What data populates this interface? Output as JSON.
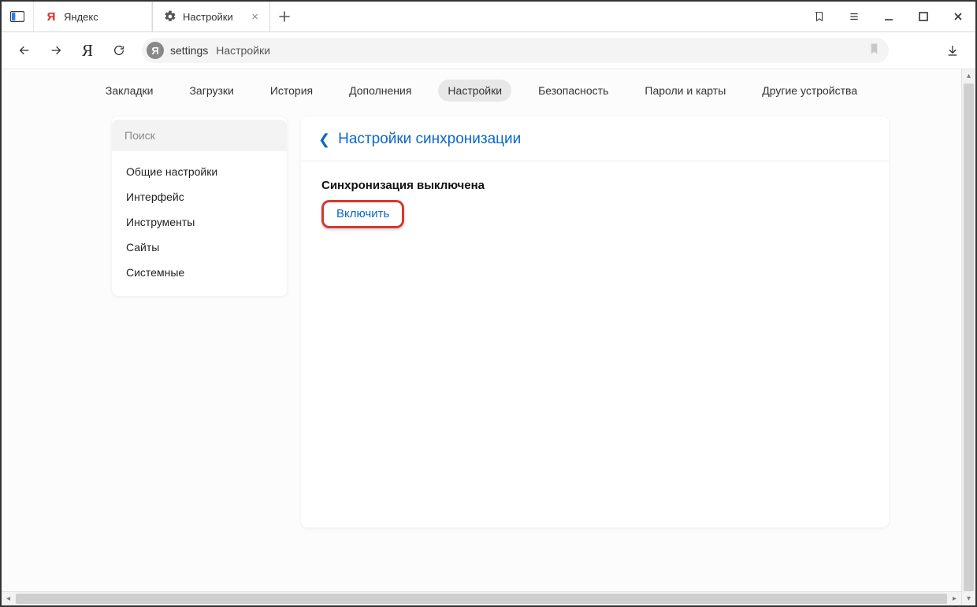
{
  "tabs": {
    "items": [
      {
        "label": "Яндекс",
        "active": false
      },
      {
        "label": "Настройки",
        "active": true
      }
    ]
  },
  "address": {
    "host": "settings",
    "rest": "Настройки"
  },
  "top_nav": {
    "items": [
      {
        "label": "Закладки",
        "active": false
      },
      {
        "label": "Загрузки",
        "active": false
      },
      {
        "label": "История",
        "active": false
      },
      {
        "label": "Дополнения",
        "active": false
      },
      {
        "label": "Настройки",
        "active": true
      },
      {
        "label": "Безопасность",
        "active": false
      },
      {
        "label": "Пароли и карты",
        "active": false
      },
      {
        "label": "Другие устройства",
        "active": false
      }
    ]
  },
  "sidebar": {
    "search_placeholder": "Поиск",
    "items": [
      {
        "label": "Общие настройки"
      },
      {
        "label": "Интерфейс"
      },
      {
        "label": "Инструменты"
      },
      {
        "label": "Сайты"
      },
      {
        "label": "Системные"
      }
    ]
  },
  "panel": {
    "back_label": "Настройки синхронизации",
    "sync_status": "Синхронизация выключена",
    "enable_label": "Включить"
  },
  "colors": {
    "accent_link": "#0a68c9",
    "highlight_border": "#d23a2f"
  }
}
